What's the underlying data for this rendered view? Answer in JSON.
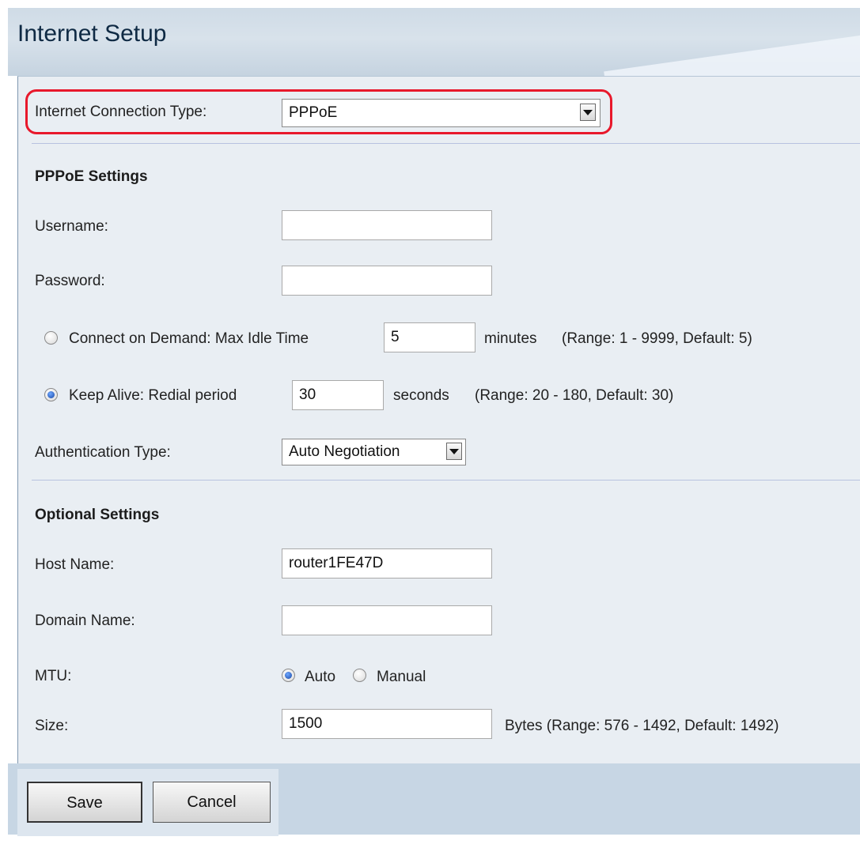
{
  "page": {
    "title": "Internet Setup"
  },
  "connection": {
    "label": "Internet Connection Type:",
    "value": "PPPoE"
  },
  "pppoe": {
    "section_title": "PPPoE Settings",
    "username_label": "Username:",
    "username_value": "",
    "password_label": "Password:",
    "password_value": "",
    "connect_on_demand": {
      "label": "Connect on Demand: Max Idle Time",
      "value": "5",
      "unit": "minutes",
      "hint": "(Range: 1 - 9999, Default: 5)",
      "selected": false
    },
    "keep_alive": {
      "label": "Keep Alive: Redial period",
      "value": "30",
      "unit": "seconds",
      "hint": "(Range: 20 - 180, Default: 30)",
      "selected": true
    },
    "auth_label": "Authentication Type:",
    "auth_value": "Auto Negotiation"
  },
  "optional": {
    "section_title": "Optional Settings",
    "host_label": "Host Name:",
    "host_value": "router1FE47D",
    "domain_label": "Domain Name:",
    "domain_value": "",
    "mtu_label": "MTU:",
    "mtu_auto_label": "Auto",
    "mtu_manual_label": "Manual",
    "mtu_selected": "Auto",
    "size_label": "Size:",
    "size_value": "1500",
    "size_hint": "Bytes (Range: 576 - 1492, Default: 1492)"
  },
  "buttons": {
    "save_label": "Save",
    "cancel_label": "Cancel"
  },
  "colors": {
    "highlight": "#e8182b",
    "header": "#cfdbe6",
    "panel": "#e9eef3",
    "radio_selected": "#1846a3"
  },
  "icons": {
    "dropdown": "chevron-down-icon"
  }
}
